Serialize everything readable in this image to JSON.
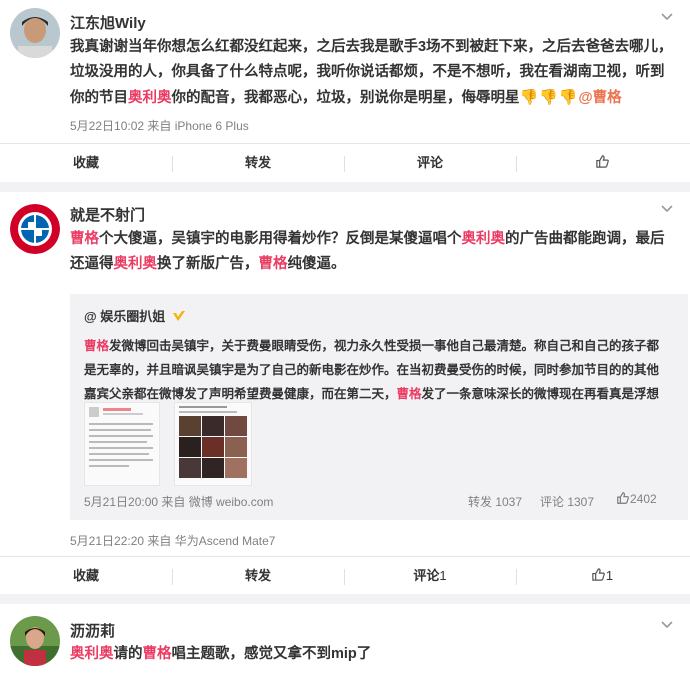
{
  "posts": [
    {
      "name": "江东旭Wily",
      "text_before": "我真谢谢当年你想怎么红都没红起来，之后去我是歌手3场不到被赶下来，之后去爸爸去哪儿，垃圾没用的人，你具备了什么特点呢，我听你说话都烦，不是不想听，我在看湖南卫视，听到你的节目",
      "hl1": "奥利奥",
      "text_mid": "你的配音，我都恶心，垃圾，别说你是明星，侮辱明星",
      "mention": "@曹格",
      "meta": "5月22日10:02 来自 iPhone 6 Plus",
      "actions": {
        "fav": "收藏",
        "repost": "转发",
        "comment": "评论",
        "like": ""
      }
    },
    {
      "name": "就是不射门",
      "text_parts": [
        "曹格",
        "个大傻逼，吴镇宇的电影用得着炒作？反倒是某傻逼唱个",
        "奥利奥",
        "的广告曲都能跑调，最后还逼得",
        "奥利奥",
        "换了新版广告，",
        "曹格",
        "纯傻逼。"
      ],
      "retweet": {
        "name": "@ 娱乐圈扒姐",
        "text_parts": [
          "曹格",
          "发微博回击吴镇宇，关于费曼眼睛受伤，视力永久性受损一事他自己最清楚。称自己和自己的孩子都是无辜的，并且暗讽吴镇宇是为了自己的新电影在炒作。在当初费曼受伤的时候，同时参加节目的的其他嘉宾父亲都在微博发了声明希望费曼健康，而在第二天，",
          "曹格",
          "发了一条意味深长的微博现在再看真是浮想联翩"
        ],
        "meta": "5月21日20:00 来自 微博 weibo.com",
        "repost": "转发 1037",
        "comment": "评论 1307",
        "like": "2402"
      },
      "meta": "5月21日22:20 来自 华为Ascend Mate7",
      "actions": {
        "fav": "收藏",
        "repost": "转发",
        "comment": "评论",
        "comment_count": "1",
        "like": "1"
      }
    },
    {
      "name": "沥沥莉",
      "text_parts": [
        "奥利奥",
        "请的",
        "曹格",
        "唱主题歌，感觉又拿不到mip了"
      ]
    }
  ],
  "colors": {
    "highlight": "#eb3c64",
    "mention": "#eb7350",
    "meta": "#808080"
  },
  "icons": [
    "chevron-down-icon",
    "thumbs-up-icon",
    "thumbs-down-emoji",
    "verified-badge-icon"
  ]
}
